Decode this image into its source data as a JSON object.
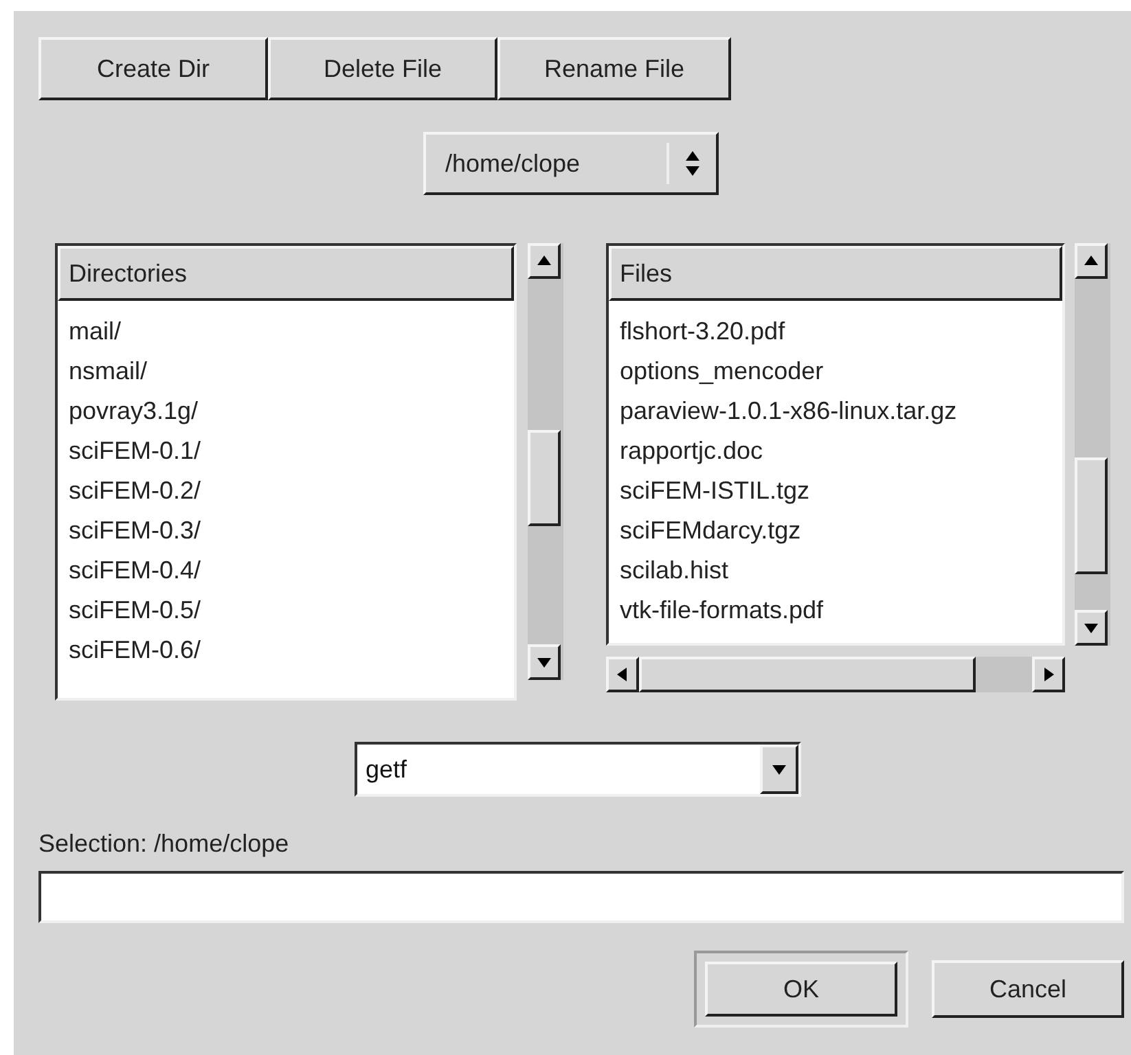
{
  "toolbar": [
    "Create Dir",
    "Delete File",
    "Rename File"
  ],
  "path_menu": {
    "value": "/home/clope"
  },
  "directories": {
    "header": "Directories",
    "items": [
      "mail/",
      "nsmail/",
      "povray3.1g/",
      "sciFEM-0.1/",
      "sciFEM-0.2/",
      "sciFEM-0.3/",
      "sciFEM-0.4/",
      "sciFEM-0.5/",
      "sciFEM-0.6/"
    ]
  },
  "files": {
    "header": "Files",
    "items": [
      "flshort-3.20.pdf",
      "options_mencoder",
      "paraview-1.0.1-x86-linux.tar.gz",
      "rapportjc.doc",
      "sciFEM-ISTIL.tgz",
      "sciFEMdarcy.tgz",
      "scilab.hist",
      "vtk-file-formats.pdf"
    ]
  },
  "filter": {
    "value": "getf"
  },
  "selection": {
    "label": "Selection: /home/clope"
  },
  "buttons": [
    {
      "label": "OK",
      "default": true
    },
    {
      "label": "Cancel",
      "default": false
    }
  ]
}
